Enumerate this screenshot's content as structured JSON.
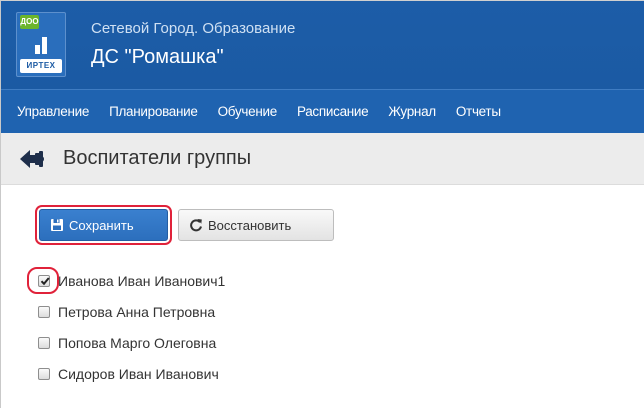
{
  "header": {
    "logo": {
      "badge": "ДОО",
      "brand": "ИРТЕХ"
    },
    "system_name": "Сетевой Город. Образование",
    "organization": "ДС \"Ромашка\""
  },
  "nav": {
    "items": [
      "Управление",
      "Планирование",
      "Обучение",
      "Расписание",
      "Журнал",
      "Отчеты"
    ]
  },
  "page": {
    "back_icon": "back-arrow-icon",
    "title": "Воспитатели группы"
  },
  "toolbar": {
    "save_label": "Сохранить",
    "save_icon": "save-icon",
    "restore_label": "Восстановить",
    "restore_icon": "refresh-icon"
  },
  "teachers": [
    {
      "name": "Иванова Иван Иванович1",
      "checked": true
    },
    {
      "name": "Петрова Анна Петровна",
      "checked": false
    },
    {
      "name": "Попова Марго Олеговна",
      "checked": false
    },
    {
      "name": "Сидоров Иван Иванович",
      "checked": false
    }
  ],
  "colors": {
    "header_bg": "#1b5aa3",
    "nav_bg": "#1f63b0",
    "primary_button": "#2c6fbd",
    "highlight": "#e0223a",
    "logo_badge": "#6cb52a"
  }
}
